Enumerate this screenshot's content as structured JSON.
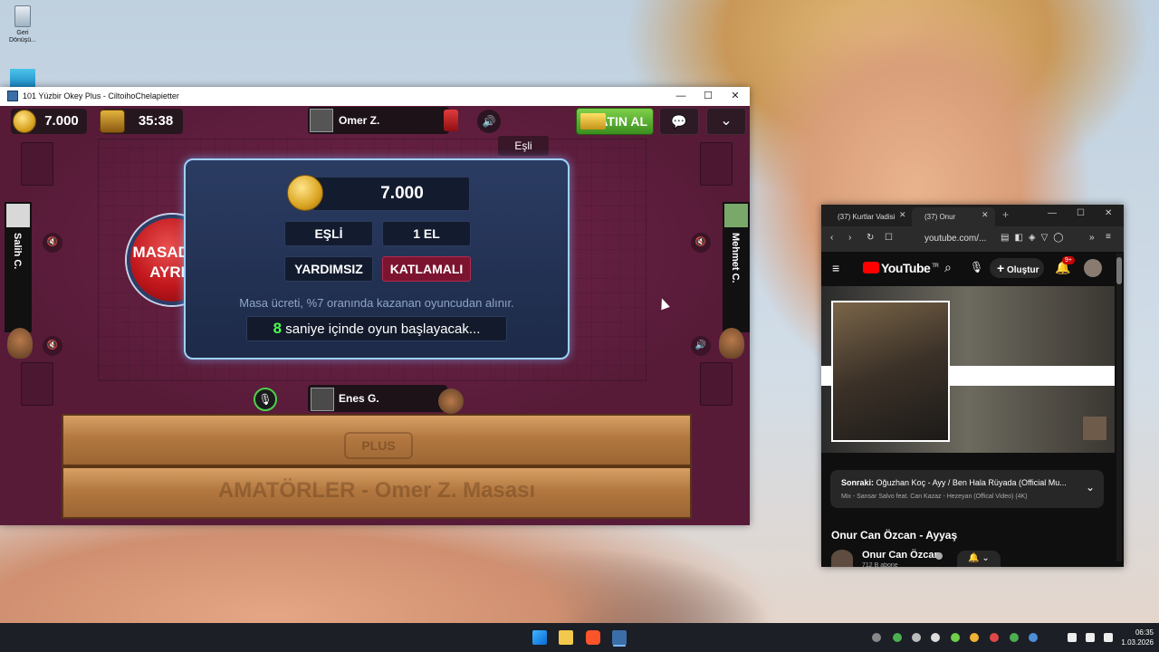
{
  "desktop": {
    "recycle_bin_label": "Geri Dönüşü..."
  },
  "game_window": {
    "title": "101 Yüzbir Okey Plus - CiltoihoChelapietter",
    "controls": {
      "minimize": "—",
      "maximize": "☐",
      "close": "✕"
    },
    "topbar": {
      "coins": "7.000",
      "timer": "35:38",
      "buy_label": "SATIN AL",
      "top_player": "Omer Z.",
      "partner_label": "Eşli"
    },
    "players": {
      "left": "Salih C.",
      "right": "Mehmet C.",
      "bottom": "Enes G."
    },
    "leave_button": {
      "line1": "MASADAN",
      "line2": "AYRIL"
    },
    "panel": {
      "stake": "7.000",
      "mode": "EŞLİ",
      "hands": "1 EL",
      "help": "YARDIMSIZ",
      "type": "KATLAMALI",
      "fee_note": "Masa ücreti, %7 oranında kazanan oyuncudan alınır.",
      "countdown_number": "8",
      "countdown_text": "saniye içinde oyun başlayacak..."
    },
    "rack": {
      "logo": "PLUS",
      "caption": "AMATÖRLER - Omer Z. Masası"
    }
  },
  "browser": {
    "tabs": [
      {
        "label": "(37) Kurtlar Vadisi"
      },
      {
        "label": "(37) Onur"
      }
    ],
    "new_tab": "+",
    "url": "youtube.com/...",
    "youtube": {
      "logo": "YouTube",
      "region": "TR",
      "create_label": "Oluştur",
      "notif_count": "9+"
    },
    "up_next": {
      "prefix": "Sonraki:",
      "title": "Oğuzhan Koç - Ayy / Ben Hala Rüyada (Official Mu...",
      "mix": "Mix - Sansar Salvo feat. Can Kazaz - Hezeyan (Offical Video) (4K)"
    },
    "video_title": "Onur Can Özcan - Ayyaş",
    "channel": "Onur Can Özcan",
    "subs": "712 B abone"
  },
  "taskbar": {
    "time": "06:35",
    "date": "1.03.2026"
  },
  "colors": {
    "game_bg": "#5e1f3a",
    "panel_border": "#9fd0ff",
    "leave_red": "#c0161b",
    "buy_green": "#4fa82b",
    "countdown_green": "#4cff4c",
    "youtube_red": "#ff0000"
  }
}
